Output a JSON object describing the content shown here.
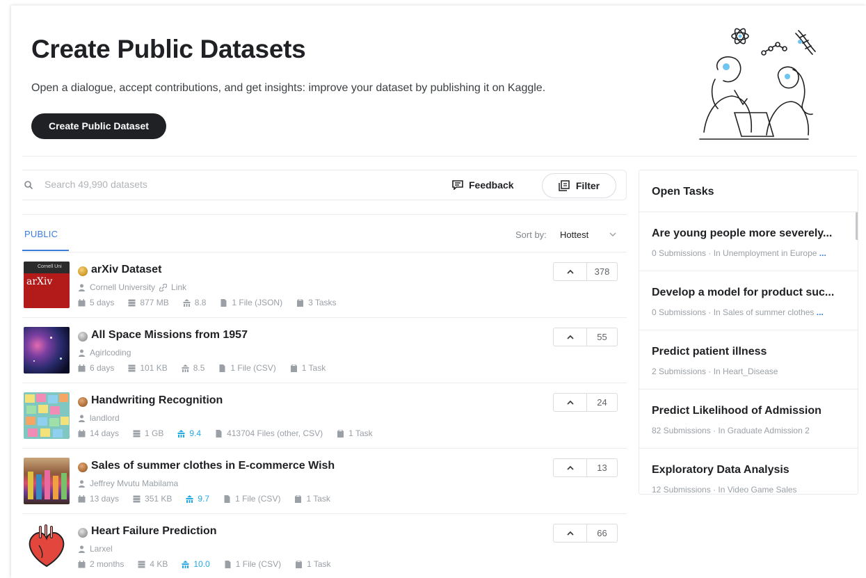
{
  "hero": {
    "title": "Create Public Datasets",
    "subtitle": "Open a dialogue, accept contributions, and get insights: improve your dataset by publishing it on Kaggle.",
    "button_label": "Create Public Dataset"
  },
  "search": {
    "placeholder": "Search 49,990 datasets",
    "feedback_label": "Feedback",
    "filter_label": "Filter"
  },
  "list": {
    "tab_label": "PUBLIC",
    "sort_label": "Sort by:",
    "sort_value": "Hottest",
    "datasets": [
      {
        "title": "arXiv Dataset",
        "medal": "gold",
        "owner": "Cornell University",
        "link_label": "Link",
        "updated": "5 days",
        "size": "877 MB",
        "usability": "8.8",
        "usability_highlight": false,
        "files": "1 File (JSON)",
        "tasks": "3 Tasks",
        "votes": "378",
        "thumb_text": "arXiv",
        "thumb_header": "Cornell Uni"
      },
      {
        "title": "All Space Missions from 1957",
        "medal": "silver",
        "owner": "Agirlcoding",
        "updated": "6 days",
        "size": "101 KB",
        "usability": "8.5",
        "usability_highlight": false,
        "files": "1 File (CSV)",
        "tasks": "1 Task",
        "votes": "55"
      },
      {
        "title": "Handwriting Recognition",
        "medal": "bronze",
        "owner": "landlord",
        "updated": "14 days",
        "size": "1 GB",
        "usability": "9.4",
        "usability_highlight": true,
        "files": "413704 Files (other, CSV)",
        "tasks": "1 Task",
        "votes": "24"
      },
      {
        "title": "Sales of summer clothes in E-commerce Wish",
        "medal": "bronze",
        "owner": "Jeffrey Mvutu Mabilama",
        "updated": "13 days",
        "size": "351 KB",
        "usability": "9.7",
        "usability_highlight": true,
        "files": "1 File (CSV)",
        "tasks": "1 Task",
        "votes": "13"
      },
      {
        "title": "Heart Failure Prediction",
        "medal": "silver",
        "owner": "Larxel",
        "updated": "2 months",
        "size": "4 KB",
        "usability": "10.0",
        "usability_highlight": true,
        "files": "1 File (CSV)",
        "tasks": "1 Task",
        "votes": "66"
      }
    ]
  },
  "tasks_panel": {
    "title": "Open Tasks",
    "items": [
      {
        "title": "Are young people more severely...",
        "meta": "0 Submissions · In Unemployment in Europe",
        "more": "..."
      },
      {
        "title": "Develop a model for product suc...",
        "meta": "0 Submissions · In Sales of summer clothes",
        "more": "..."
      },
      {
        "title": "Predict patient illness",
        "meta": "2 Submissions · In Heart_Disease",
        "more": ""
      },
      {
        "title": "Predict Likelihood of Admission",
        "meta": "82 Submissions · In Graduate Admission 2",
        "more": ""
      },
      {
        "title": "Exploratory Data Analysis",
        "meta": "12 Submissions · In Video Game Sales",
        "more": ""
      }
    ]
  },
  "colors": {
    "accent": "#3b7ddd",
    "usability_highlight": "#20a8e0",
    "gold": "#d3a02f",
    "silver": "#a5a5a5",
    "bronze": "#b0713a",
    "button_dark": "#202124"
  }
}
